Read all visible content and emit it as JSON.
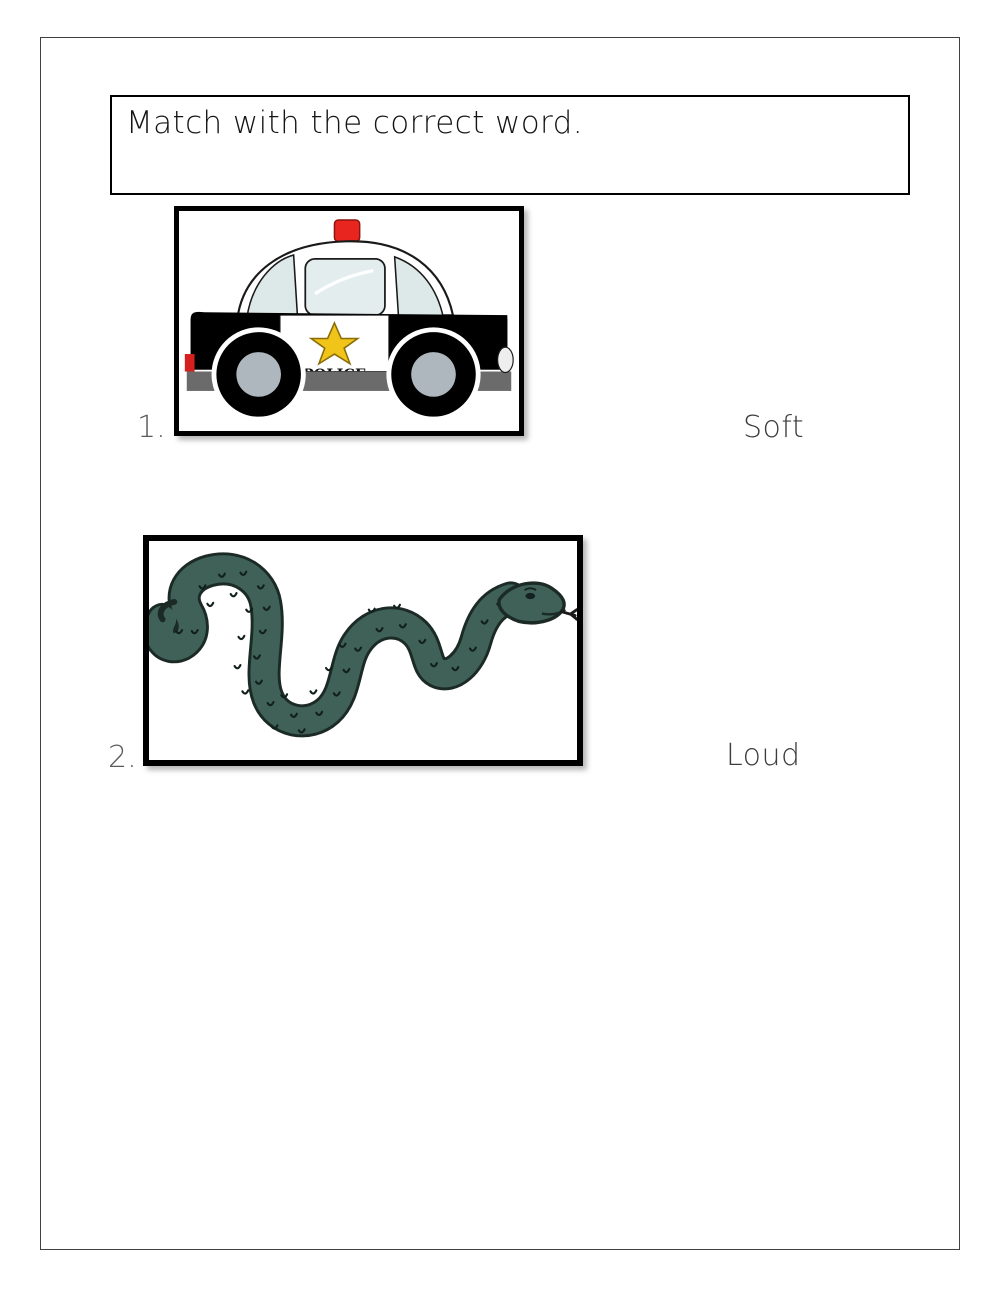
{
  "page": {
    "title": "Match with the correct word.",
    "background_color": "#ffffff",
    "border_color": "#404040"
  },
  "instruction": {
    "text": "Match with the correct word.",
    "box_border_color": "#000000"
  },
  "items": [
    {
      "number": "1.",
      "image_name": "police-car",
      "image_alt_text": "POLICE",
      "frame_border_color": "#000000",
      "colors": {
        "light_bar": "#e8251f",
        "body_dark": "#000000",
        "window": "#dde8e8",
        "star": "#f0c419",
        "hubcap": "#adb7bd",
        "bumper": "#6b6b6b"
      }
    },
    {
      "number": "2.",
      "image_name": "snake",
      "image_alt_text": "",
      "frame_border_color": "#000000",
      "colors": {
        "body": "#3f6157",
        "outline": "#1c2a26",
        "tongue": "#1a1a1a"
      }
    }
  ],
  "words": [
    {
      "label": "Soft"
    },
    {
      "label": "Loud"
    }
  ]
}
